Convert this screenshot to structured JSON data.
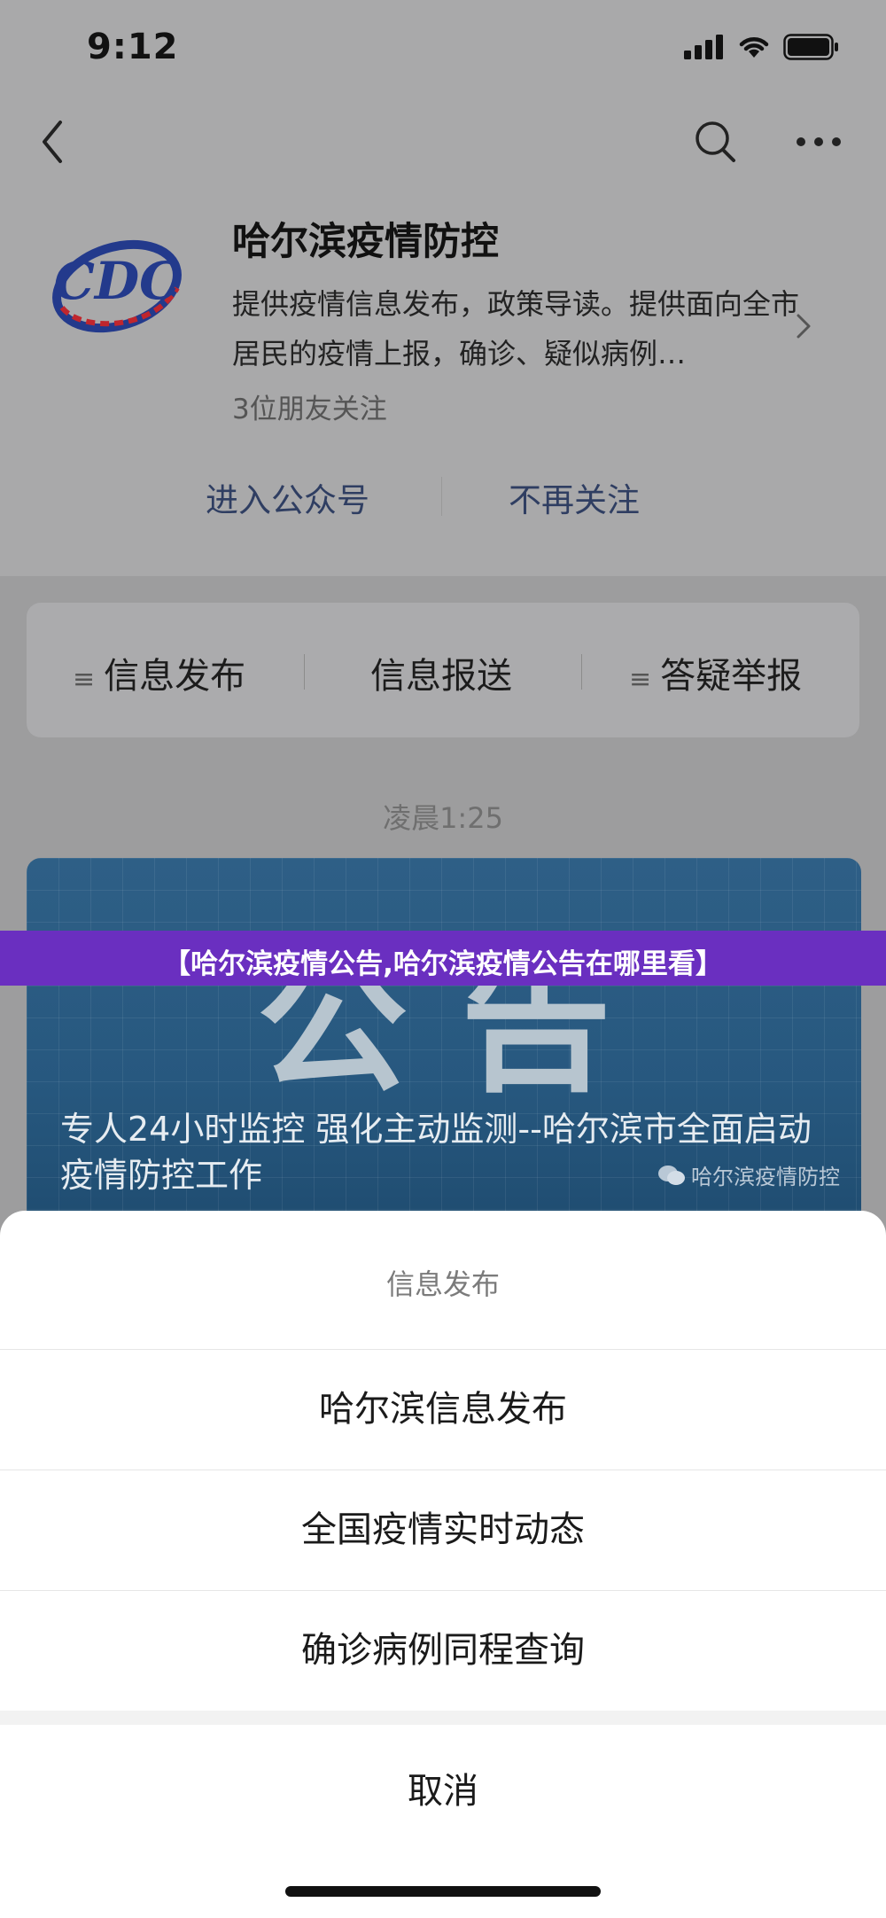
{
  "status_bar": {
    "time": "9:12"
  },
  "account": {
    "name": "哈尔滨疫情防控",
    "description": "提供疫情信息发布，政策导读。提供面向全市居民的疫情上报，确诊、疑似病例…",
    "followers": "3位朋友关注",
    "enter_label": "进入公众号",
    "unfollow_label": "不再关注",
    "logo_text": "CDC"
  },
  "menu": {
    "items": [
      {
        "label": "信息发布",
        "icon": "list-icon"
      },
      {
        "label": "信息报送",
        "icon": ""
      },
      {
        "label": "答疑举报",
        "icon": "list-icon"
      }
    ]
  },
  "message": {
    "timestamp": "凌晨1:25",
    "cover_word": "公告",
    "title": "专人24小时监控 强化主动监测--哈尔滨市全面启动疫情防控工作",
    "watermark": "哈尔滨疫情防控"
  },
  "banner": {
    "text": "【哈尔滨疫情公告,哈尔滨疫情公告在哪里看】"
  },
  "action_sheet": {
    "title": "信息发布",
    "options": [
      "哈尔滨信息发布",
      "全国疫情实时动态",
      "确诊病例同程查询"
    ],
    "cancel": "取消"
  },
  "colors": {
    "banner": "#6a2fc0",
    "link": "#2f3e62",
    "dim_overlay": "#a9a9aa"
  }
}
